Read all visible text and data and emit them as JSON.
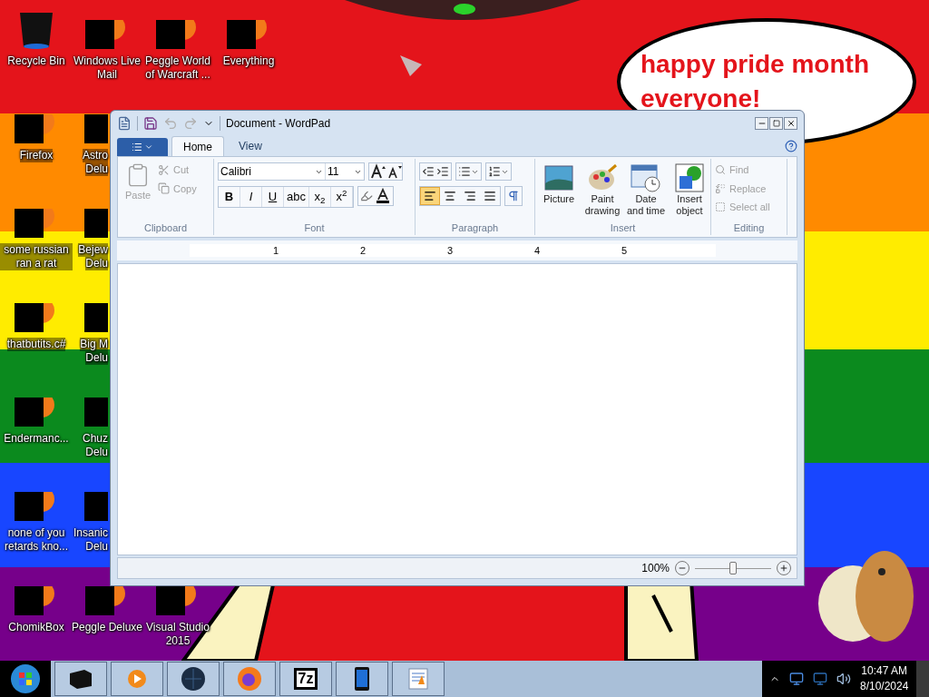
{
  "desktop_icons": [
    {
      "label": "Recycle Bin",
      "kind": "bin"
    },
    {
      "label": "Windows Live Mail",
      "kind": "redacted"
    },
    {
      "label": "Peggle World of Warcraft ...",
      "kind": "redacted"
    },
    {
      "label": "Everything",
      "kind": "redacted"
    },
    {
      "label": "Firefox",
      "kind": "redacted"
    },
    {
      "label": "Astro Delu",
      "kind": "partial"
    },
    {
      "label": "some russian ran a rat",
      "kind": "redacted"
    },
    {
      "label": "Bejew Delu",
      "kind": "partial"
    },
    {
      "label": "thatbutits.c#",
      "kind": "redacted"
    },
    {
      "label": "Big M Delu",
      "kind": "partial"
    },
    {
      "label": "Endermanc...",
      "kind": "redacted"
    },
    {
      "label": "Chuz Delu",
      "kind": "partial"
    },
    {
      "label": "none of you retards kno...",
      "kind": "redacted"
    },
    {
      "label": "Insanic Delu",
      "kind": "partial"
    },
    {
      "label": "ChomikBox",
      "kind": "redacted"
    },
    {
      "label": "Peggle Deluxe",
      "kind": "redacted"
    },
    {
      "label": "Visual Studio 2015",
      "kind": "redacted"
    }
  ],
  "wallpaper": {
    "caption": "happy pride month everyone!"
  },
  "window": {
    "title": "Document - WordPad",
    "tabs": [
      {
        "label": "Home",
        "selected": true
      },
      {
        "label": "View",
        "selected": false
      }
    ],
    "clipboard": {
      "label": "Clipboard",
      "paste": {
        "label": "Paste",
        "disabled": true
      },
      "cut": {
        "label": "Cut",
        "disabled": true
      },
      "copy": {
        "label": "Copy",
        "disabled": true
      }
    },
    "font": {
      "label": "Font",
      "family": "Calibri",
      "size": "11",
      "formats": [
        "B",
        "I",
        "U",
        "abc",
        "x$_{2}$",
        "x$^{2}$"
      ]
    },
    "paragraph": {
      "label": "Paragraph",
      "align": [
        {
          "kind": "left",
          "selected": true
        },
        {
          "kind": "center",
          "selected": false
        },
        {
          "kind": "right",
          "selected": false
        },
        {
          "kind": "justify",
          "selected": false
        }
      ]
    },
    "insert": {
      "label": "Insert",
      "buttons": [
        {
          "kind": "picture",
          "label": "Picture"
        },
        {
          "kind": "paint",
          "label": "Paint drawing"
        },
        {
          "kind": "datetime",
          "label": "Date and time"
        },
        {
          "kind": "object",
          "label": "Insert object"
        }
      ]
    },
    "editing": {
      "label": "Editing",
      "buttons": [
        {
          "kind": "find",
          "label": "Find",
          "disabled": true
        },
        {
          "kind": "replace",
          "label": "Replace",
          "disabled": true
        },
        {
          "kind": "selectall",
          "label": "Select all",
          "disabled": true
        }
      ]
    },
    "ruler": [
      "1",
      "2",
      "3",
      "4",
      "5"
    ],
    "status_bar": {
      "zoom": "100%",
      "level": 0.5
    }
  },
  "taskbar": {
    "buttons": [
      {
        "kind": "box"
      },
      {
        "kind": "media"
      },
      {
        "kind": "globe"
      },
      {
        "kind": "firefox"
      },
      {
        "kind": "sevenzip",
        "label": "7z"
      },
      {
        "kind": "phone"
      },
      {
        "kind": "wordpad"
      }
    ],
    "time": "10:47 AM",
    "date": "8/10/2024"
  }
}
